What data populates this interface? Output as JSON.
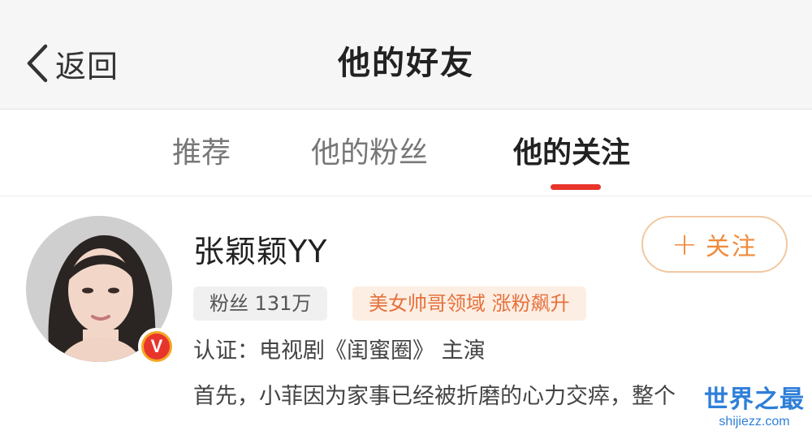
{
  "header": {
    "back_label": "返回",
    "title": "他的好友"
  },
  "tabs": [
    {
      "label": "推荐",
      "active": false
    },
    {
      "label": "他的粉丝",
      "active": false
    },
    {
      "label": "他的关注",
      "active": true
    }
  ],
  "accent_color": "#e8352c",
  "user": {
    "name": "张颖颖YY",
    "fans_badge": "粉丝 131万",
    "tag_badge": "美女帅哥领域 涨粉飙升",
    "certification": "认证：电视剧《闺蜜圈》 主演",
    "description": "首先，小菲因为家事已经被折磨的心力交瘁，整个",
    "verified_badge": "V",
    "follow_button": {
      "icon": "plus-icon",
      "label": "关注"
    }
  },
  "watermark": {
    "main": "世界之最",
    "sub": "shijiezz.com"
  }
}
